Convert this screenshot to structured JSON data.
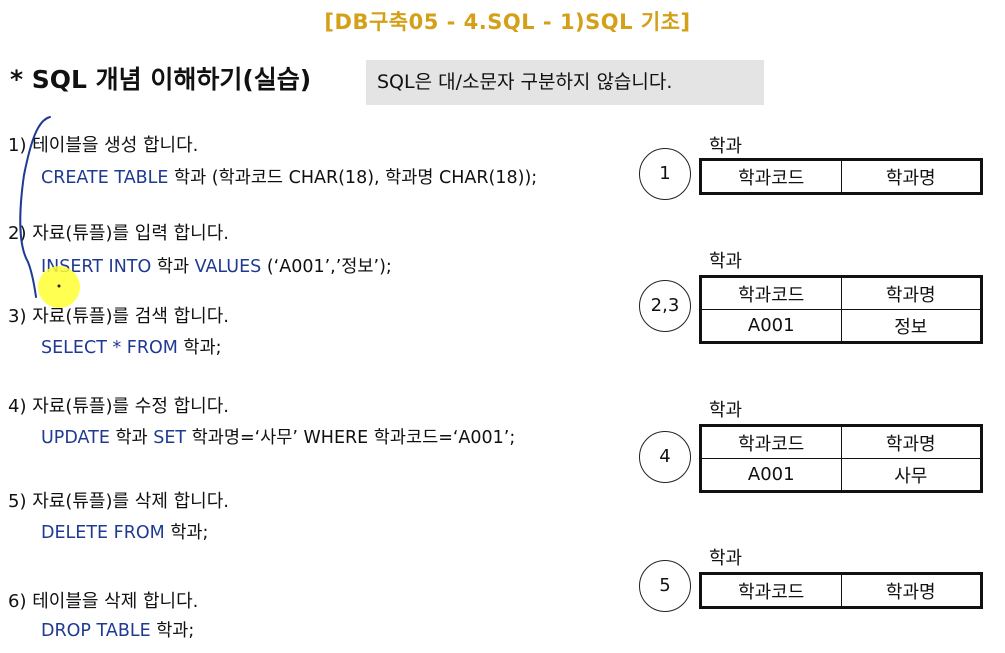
{
  "header": {
    "title": "[DB구축05 - 4.SQL - 1)SQL 기초]"
  },
  "section": {
    "title": "* SQL 개념 이해하기(실습)",
    "note": "SQL은 대/소문자 구분하지 않습니다."
  },
  "steps": [
    {
      "title": "1) 테이블을 생성 합니다.",
      "keyword": "CREATE TABLE",
      "rest": " 학과 (학과코드 CHAR(18), 학과명 CHAR(18));"
    },
    {
      "title": "2) 자료(튜플)를 입력 합니다.",
      "keyword": "INSERT INTO",
      "mid": " 학과 ",
      "keyword2": "VALUES",
      "rest": " (‘A001’,’정보’);"
    },
    {
      "title": "3) 자료(튜플)를 검색 합니다.",
      "keyword": "SELECT * FROM",
      "rest": " 학과;"
    },
    {
      "title": "4) 자료(튜플)를 수정 합니다.",
      "keyword": "UPDATE",
      "mid": " 학과 ",
      "keyword2": "SET",
      "rest": " 학과명=‘사무’ WHERE 학과코드=‘A001’;"
    },
    {
      "title": "5) 자료(튜플)를 삭제 합니다.",
      "keyword": "DELETE FROM",
      "rest": " 학과;"
    },
    {
      "title": "6) 테이블을 삭제 합니다.",
      "keyword": "DROP TABLE",
      "rest": " 학과;"
    }
  ],
  "tables": [
    {
      "label": "학과",
      "circle": "1",
      "headers": [
        "학과코드",
        "학과명"
      ],
      "rows": []
    },
    {
      "label": "학과",
      "circle": "2,3",
      "headers": [
        "학과코드",
        "학과명"
      ],
      "rows": [
        [
          "A001",
          "정보"
        ]
      ]
    },
    {
      "label": "학과",
      "circle": "4",
      "headers": [
        "학과코드",
        "학과명"
      ],
      "rows": [
        [
          "A001",
          "사무"
        ]
      ]
    },
    {
      "label": "학과",
      "circle": "5",
      "headers": [
        "학과코드",
        "학과명"
      ],
      "rows": []
    }
  ],
  "colors": {
    "title": "#d4a017",
    "keyword": "#1f3a93",
    "highlight": "#ffff33",
    "pen": "#1f3a93",
    "note_bg": "#e4e4e4"
  }
}
